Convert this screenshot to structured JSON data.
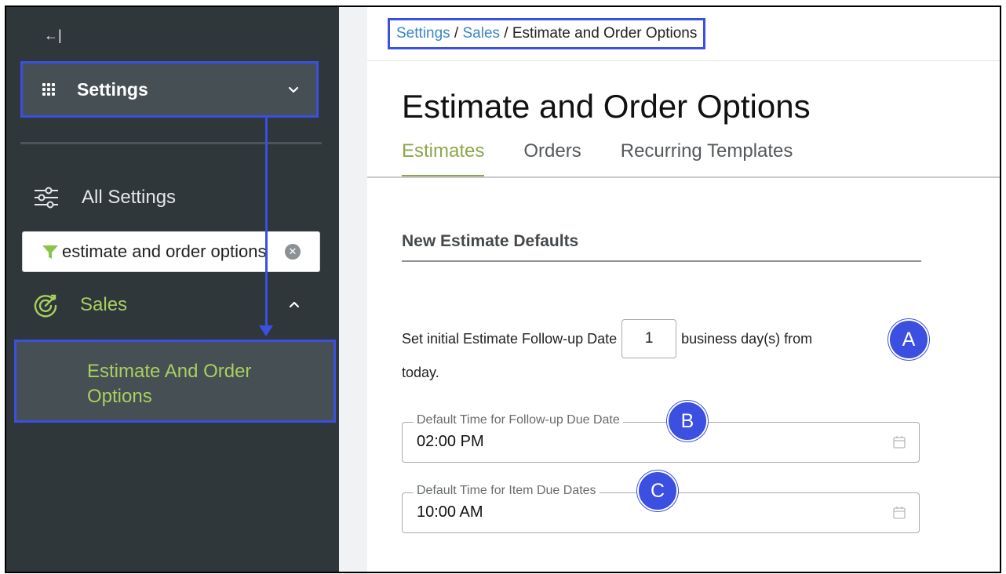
{
  "sidebar": {
    "collapse_icon": "collapse-left-icon",
    "header": {
      "title": "Settings",
      "icon": "grid-icon"
    },
    "all_settings": {
      "label": "All Settings",
      "icon": "sliders-icon"
    },
    "filter": {
      "value": "estimate and order options",
      "icon": "filter-icon"
    },
    "sales": {
      "label": "Sales",
      "icon": "sales-target-icon"
    },
    "active_item": {
      "label": "Estimate And Order Options"
    }
  },
  "breadcrumb": {
    "items": [
      "Settings",
      "Sales"
    ],
    "separator": " / ",
    "current": "Estimate and Order Options"
  },
  "page": {
    "title": "Estimate and Order Options",
    "tabs": [
      {
        "label": "Estimates",
        "active": true
      },
      {
        "label": "Orders",
        "active": false
      },
      {
        "label": "Recurring Templates",
        "active": false
      }
    ],
    "section_title": "New Estimate Defaults",
    "followup": {
      "prefix": "Set initial Estimate Follow-up Date",
      "value": "1",
      "suffix": "business day(s) from",
      "line2": "today."
    },
    "fields": [
      {
        "legend": "Default Time for Follow-up Due Date",
        "value": "02:00 PM"
      },
      {
        "legend": "Default Time for Item Due Dates",
        "value": "10:00 AM"
      }
    ]
  },
  "markers": [
    "A",
    "B",
    "C"
  ],
  "colors": {
    "sidebar_bg": "#2f373b",
    "sidebar_active_bg": "#464f53",
    "accent_green": "#a8cf62",
    "tab_green": "#8aa84a",
    "annotation_blue": "#3b4fe0",
    "link_blue": "#3a88c4"
  }
}
